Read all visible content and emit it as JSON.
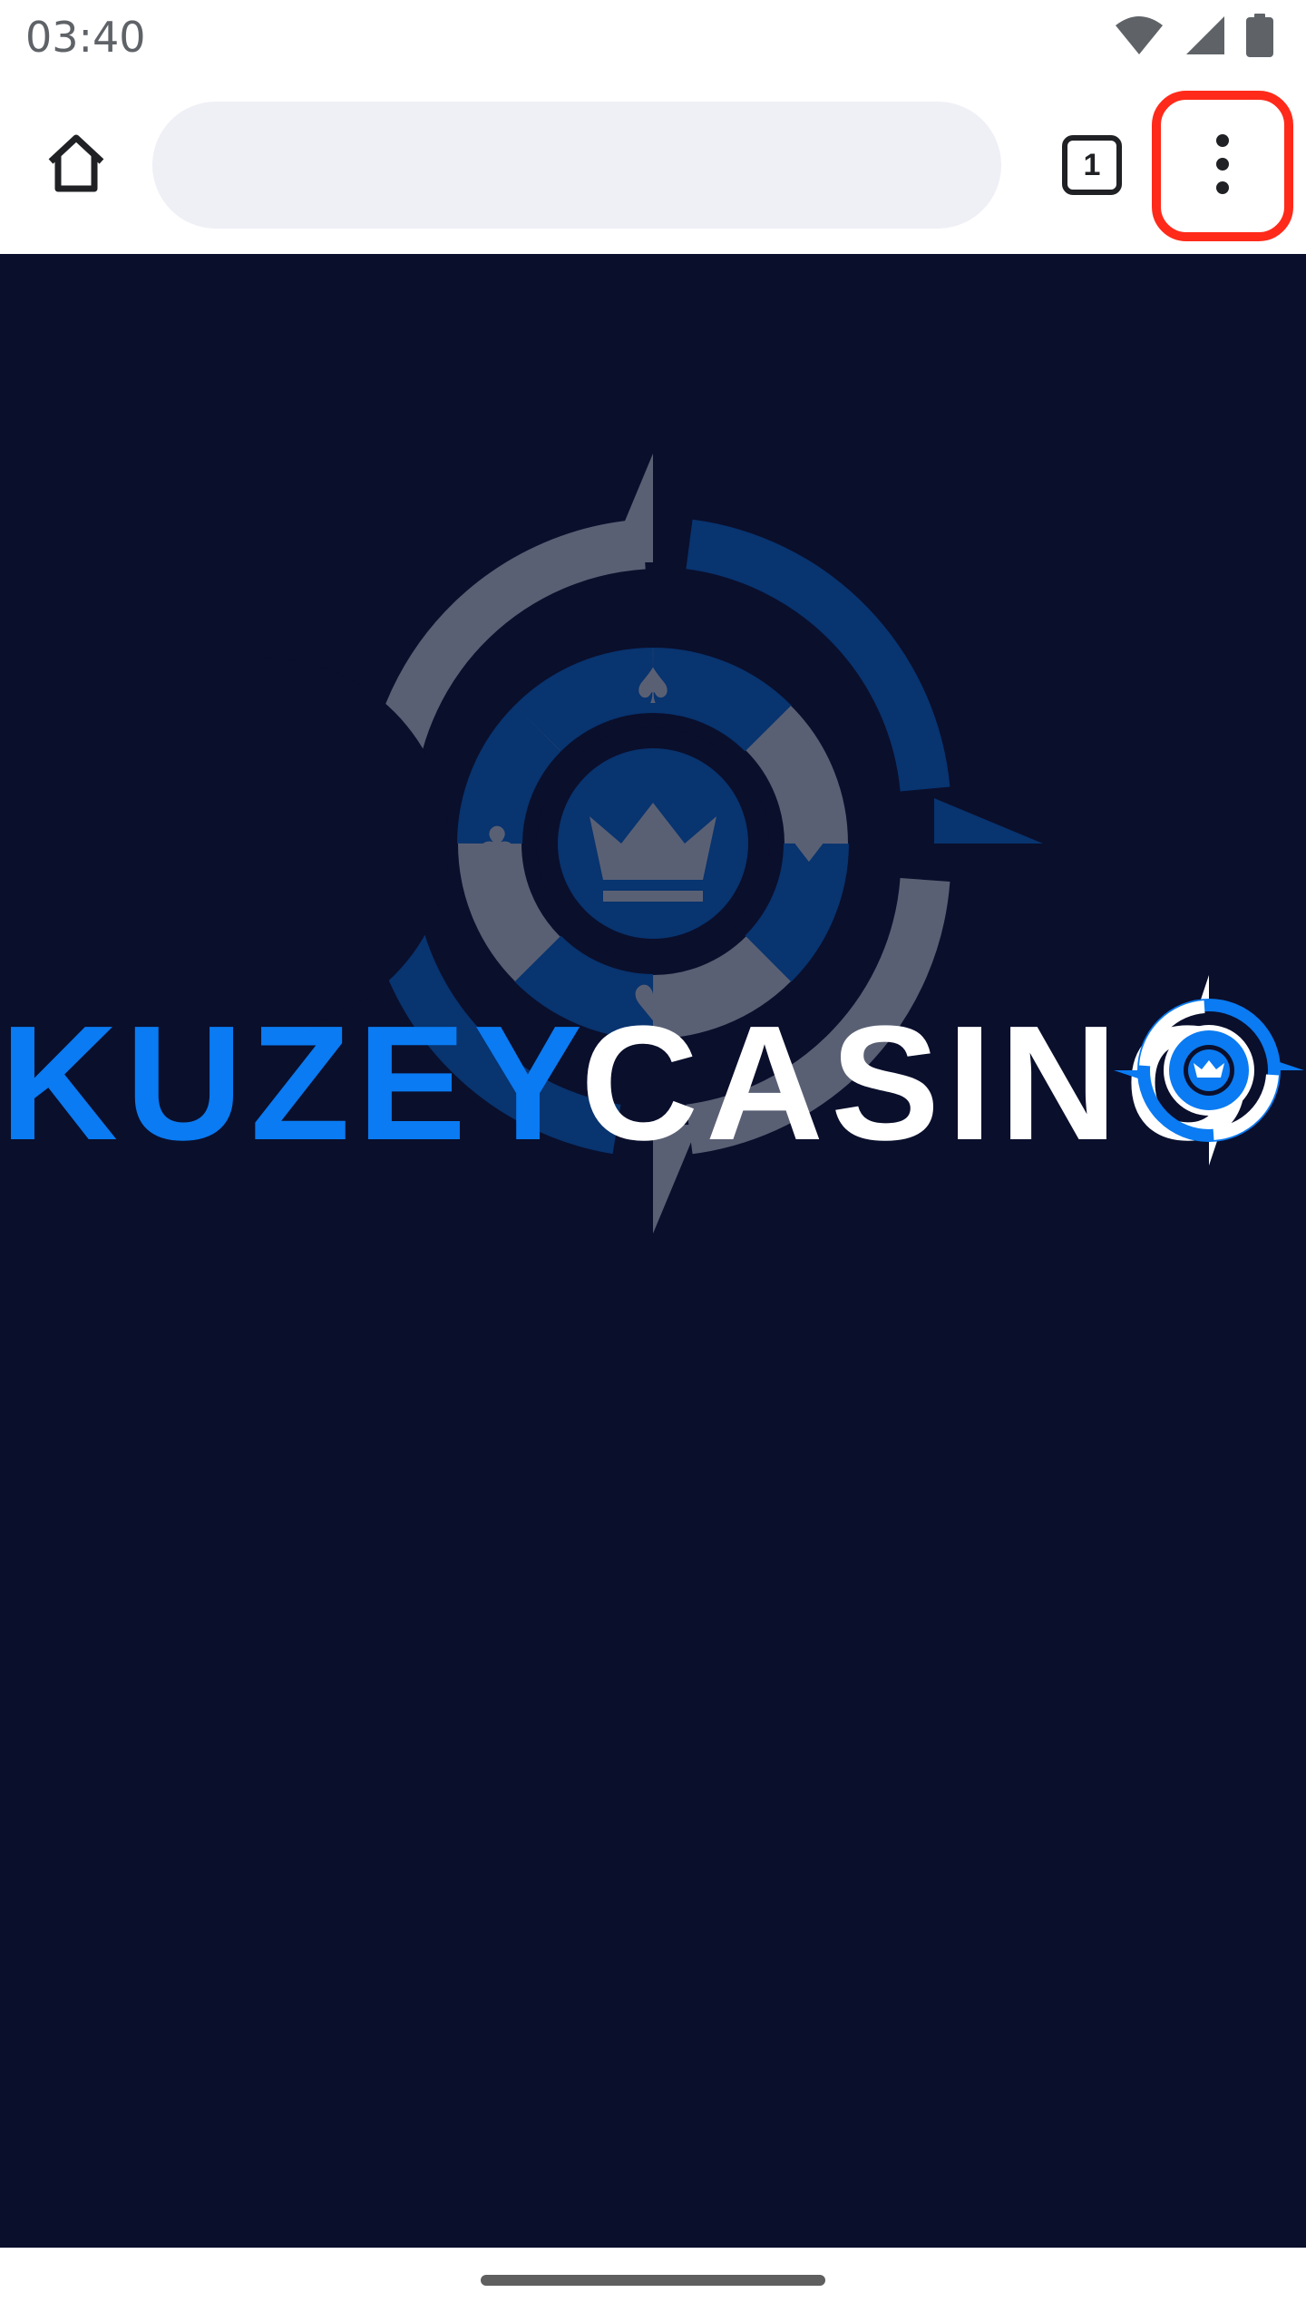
{
  "status_bar": {
    "time": "03:40",
    "icons": [
      "wifi-icon",
      "signal-icon",
      "battery-icon"
    ]
  },
  "toolbar": {
    "url_value": "",
    "url_placeholder": "",
    "tabs_count": "1",
    "menu_highlight_color": "#ff2a1a"
  },
  "page": {
    "background_color": "#0a0f2c",
    "logo": {
      "word1": "KUZEY",
      "word2": "CASINO",
      "word1_color": "#0a7bf2",
      "word2_color": "#ffffff"
    }
  }
}
